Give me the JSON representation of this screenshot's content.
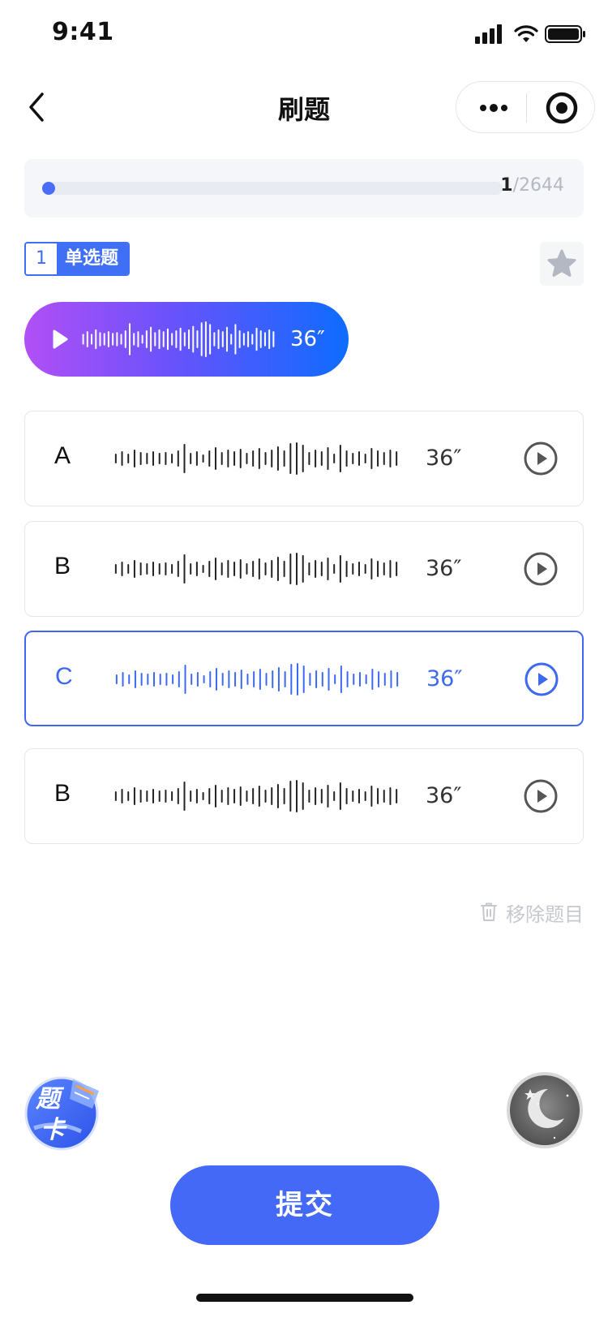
{
  "status_bar": {
    "time": "9:41"
  },
  "nav": {
    "title": "刷题"
  },
  "progress": {
    "current": "1",
    "total": "/2644",
    "fraction": 0.0004
  },
  "question": {
    "number": "1",
    "type": "单选题",
    "audio_duration": "36″"
  },
  "options": [
    {
      "letter": "A",
      "duration": "36″",
      "selected": false
    },
    {
      "letter": "B",
      "duration": "36″",
      "selected": false
    },
    {
      "letter": "C",
      "duration": "36″",
      "selected": true
    },
    {
      "letter": "B",
      "duration": "36″",
      "selected": false
    }
  ],
  "actions": {
    "remove_label": "移除题目",
    "card_label": "题卡",
    "card_char_1": "题",
    "card_char_2": "卡",
    "submit_label": "提交"
  },
  "colors": {
    "accent": "#4569f7",
    "selected_border": "#3d68f0",
    "gradient_start": "#b150f5",
    "gradient_end": "#0d6cff"
  },
  "icons": [
    "back-icon",
    "more-icon",
    "close-target-icon",
    "star-icon",
    "play-icon",
    "trash-icon",
    "moon-icon"
  ]
}
